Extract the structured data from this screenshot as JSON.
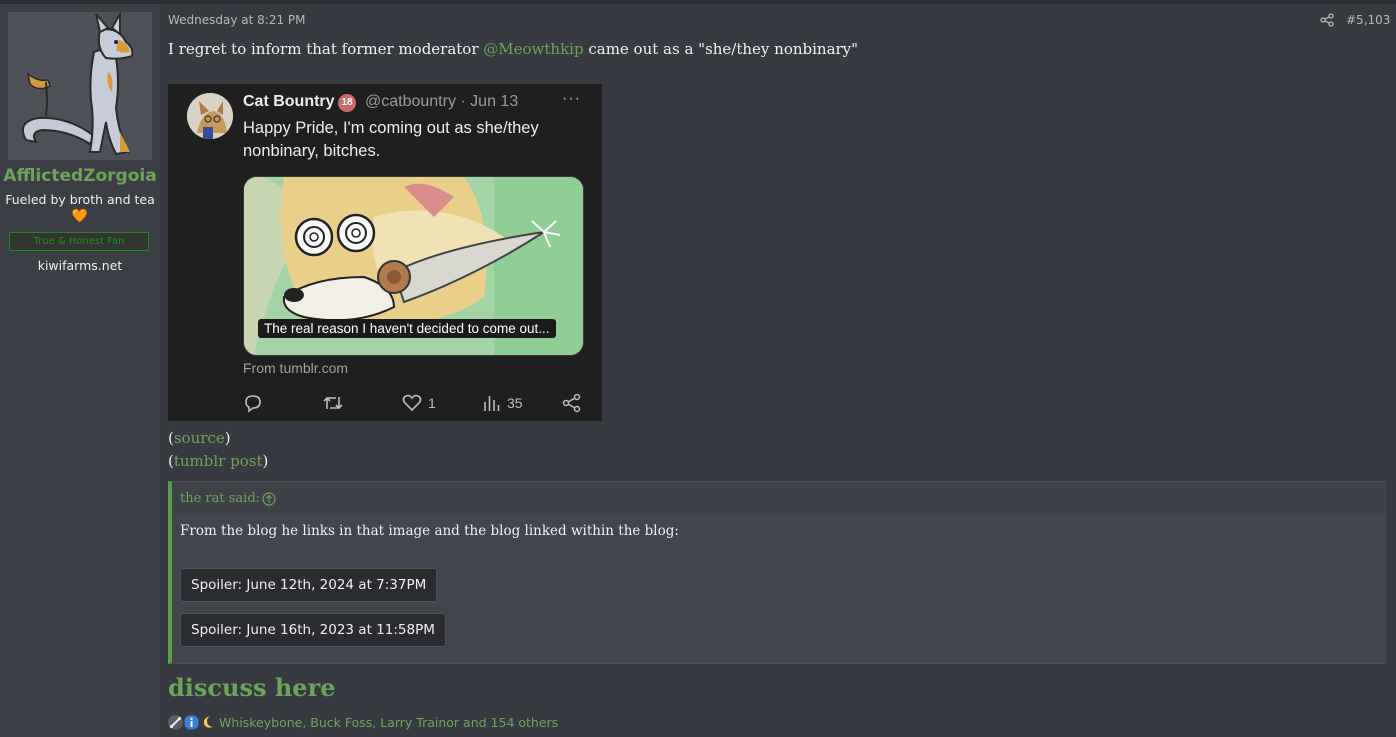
{
  "sidebar": {
    "username": "AfflictedZorgoia",
    "user_title": "Fueled by broth and tea",
    "heart": "🧡",
    "banner": "True & Honest Fan",
    "site": "kiwifarms.net"
  },
  "post": {
    "timestamp": "Wednesday at 8:21 PM",
    "number": "#5,103",
    "text_before": "I regret to inform that former moderator ",
    "mention": "@Meowthkip",
    "text_after": " came out as a \"she/they nonbinary\"",
    "source_label": "source",
    "tumblr_label": "tumblr post",
    "discuss": "discuss here"
  },
  "tweet": {
    "name": "Cat Bountry",
    "badge": "18",
    "handle_date": "@catbountry · Jun 13",
    "more": "···",
    "text": "Happy Pride, I'm coming out as she/they nonbinary, bitches.",
    "caption": "The real reason I haven't decided to come out...",
    "from": "From tumblr.com",
    "likes": "1",
    "views": "35"
  },
  "quote": {
    "attribution": "the rat said:",
    "body": "From the blog he links in that image and the blog linked within the blog:",
    "spoilers": [
      "Spoiler: June 12th, 2024 at 7:37PM",
      "Spoiler: June 16th, 2023 at 11:58PM"
    ]
  },
  "reactions": {
    "icons": [
      "bone-icon",
      "info-icon",
      "moon-icon"
    ],
    "users": "Whiskeybone, Buck Foss, Larry Trainor and 154 others"
  }
}
